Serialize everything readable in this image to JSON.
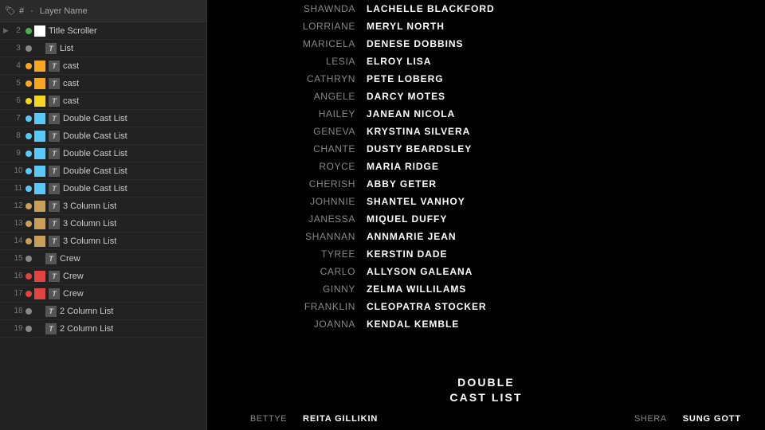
{
  "leftPanel": {
    "header": {
      "tag_icon": "🏷",
      "hash_col": "#",
      "dot_col": "·",
      "layer_name_col": "Layer Name"
    },
    "layers": [
      {
        "num": 2,
        "expand": true,
        "dot_color": "#4CAF50",
        "color": "#fff",
        "color_type": "rect",
        "type_icon": null,
        "label": "Title Scroller",
        "selected": false
      },
      {
        "num": 3,
        "expand": false,
        "dot_color": "#888",
        "color": "#888",
        "color_type": "none",
        "type_icon": "T",
        "label": "List",
        "selected": false
      },
      {
        "num": 4,
        "expand": false,
        "dot_color": "#f5a623",
        "color": "#f5a623",
        "color_type": "rect",
        "type_icon": "T",
        "label": "cast",
        "selected": false
      },
      {
        "num": 5,
        "expand": false,
        "dot_color": "#f5a623",
        "color": "#f5a623",
        "color_type": "rect",
        "type_icon": "T",
        "label": "cast",
        "selected": false
      },
      {
        "num": 6,
        "expand": false,
        "dot_color": "#f5d623",
        "color": "#f5d623",
        "color_type": "rect",
        "type_icon": "T",
        "label": "cast",
        "selected": false
      },
      {
        "num": 7,
        "expand": false,
        "dot_color": "#5bc8f5",
        "color": "#5bc8f5",
        "color_type": "rect",
        "type_icon": "T",
        "label": "Double Cast List",
        "selected": false
      },
      {
        "num": 8,
        "expand": false,
        "dot_color": "#5bc8f5",
        "color": "#5bc8f5",
        "color_type": "rect",
        "type_icon": "T",
        "label": "Double Cast List",
        "selected": false
      },
      {
        "num": 9,
        "expand": false,
        "dot_color": "#5bc8f5",
        "color": "#5bc8f5",
        "color_type": "rect",
        "type_icon": "T",
        "label": "Double Cast List",
        "selected": false
      },
      {
        "num": 10,
        "expand": false,
        "dot_color": "#5bc8f5",
        "color": "#5bc8f5",
        "color_type": "rect",
        "type_icon": "T",
        "label": "Double Cast List",
        "selected": false
      },
      {
        "num": 11,
        "expand": false,
        "dot_color": "#5bc8f5",
        "color": "#5bc8f5",
        "color_type": "rect",
        "type_icon": "T",
        "label": "Double Cast List",
        "selected": false
      },
      {
        "num": 12,
        "expand": false,
        "dot_color": "#c8a05b",
        "color": "#c8a05b",
        "color_type": "rect",
        "type_icon": "T",
        "label": "3 Column List",
        "selected": false
      },
      {
        "num": 13,
        "expand": false,
        "dot_color": "#c8a05b",
        "color": "#c8a05b",
        "color_type": "rect",
        "type_icon": "T",
        "label": "3 Column List",
        "selected": false
      },
      {
        "num": 14,
        "expand": false,
        "dot_color": "#c8a05b",
        "color": "#c8a05b",
        "color_type": "rect",
        "type_icon": "T",
        "label": "3 Column List",
        "selected": false
      },
      {
        "num": 15,
        "expand": false,
        "dot_color": "#888",
        "color": "#888",
        "color_type": "none",
        "type_icon": "T",
        "label": "Crew",
        "selected": false
      },
      {
        "num": 16,
        "expand": false,
        "dot_color": "#e24444",
        "color": "#e24444",
        "color_type": "rect",
        "type_icon": "T",
        "label": "Crew",
        "selected": false
      },
      {
        "num": 17,
        "expand": false,
        "dot_color": "#e24444",
        "color": "#e24444",
        "color_type": "rect",
        "type_icon": "T",
        "label": "Crew",
        "selected": false
      },
      {
        "num": 18,
        "expand": false,
        "dot_color": "#888",
        "color": "#888",
        "color_type": "none",
        "type_icon": "T",
        "label": "2 Column List",
        "selected": false
      },
      {
        "num": 19,
        "expand": false,
        "dot_color": "#888",
        "color": "#888",
        "color_type": "none",
        "type_icon": "T",
        "label": "2 Column List",
        "selected": false
      }
    ]
  },
  "rightPanel": {
    "castList": [
      {
        "first": "SHAWNDA",
        "last": "LACHELLE BLACKFORD"
      },
      {
        "first": "LORRIANE",
        "last": "MERYL NORTH"
      },
      {
        "first": "MARICELA",
        "last": "DENESE DOBBINS"
      },
      {
        "first": "LESIA",
        "last": "ELROY LISA"
      },
      {
        "first": "CATHRYN",
        "last": "PETE LOBERG"
      },
      {
        "first": "ANGELE",
        "last": "DARCY MOTES"
      },
      {
        "first": "HAILEY",
        "last": "JANEAN NICOLA"
      },
      {
        "first": "GENEVA",
        "last": "KRYSTINA SILVERA"
      },
      {
        "first": "CHANTE",
        "last": "DUSTY BEARDSLEY"
      },
      {
        "first": "ROYCE",
        "last": "MARIA RIDGE"
      },
      {
        "first": "CHERISH",
        "last": "ABBY GETER"
      },
      {
        "first": "JOHNNIE",
        "last": "SHANTEL VANHOY"
      },
      {
        "first": "JANESSA",
        "last": "MIQUEL DUFFY"
      },
      {
        "first": "SHANNAN",
        "last": "ANNMARIE JEAN"
      },
      {
        "first": "TYREE",
        "last": "KERSTIN DADE"
      },
      {
        "first": "CARLO",
        "last": "ALLYSON GALEANA"
      },
      {
        "first": "GINNY",
        "last": "ZELMA WILLILAMS"
      },
      {
        "first": "FRANKLIN",
        "last": "CLEOPATRA STOCKER"
      },
      {
        "first": "JOANNA",
        "last": "KENDAL KEMBLE"
      }
    ],
    "doubleCastSection": {
      "title_line1": "DOUBLE",
      "title_line2": "CAST LIST"
    },
    "doubleCastLeft": [
      {
        "first": "BETTYE",
        "last": "REITA GILLIKIN"
      }
    ],
    "doubleCastRight": [
      {
        "first": "SHERA",
        "last": "SUNG GOTT"
      }
    ]
  }
}
